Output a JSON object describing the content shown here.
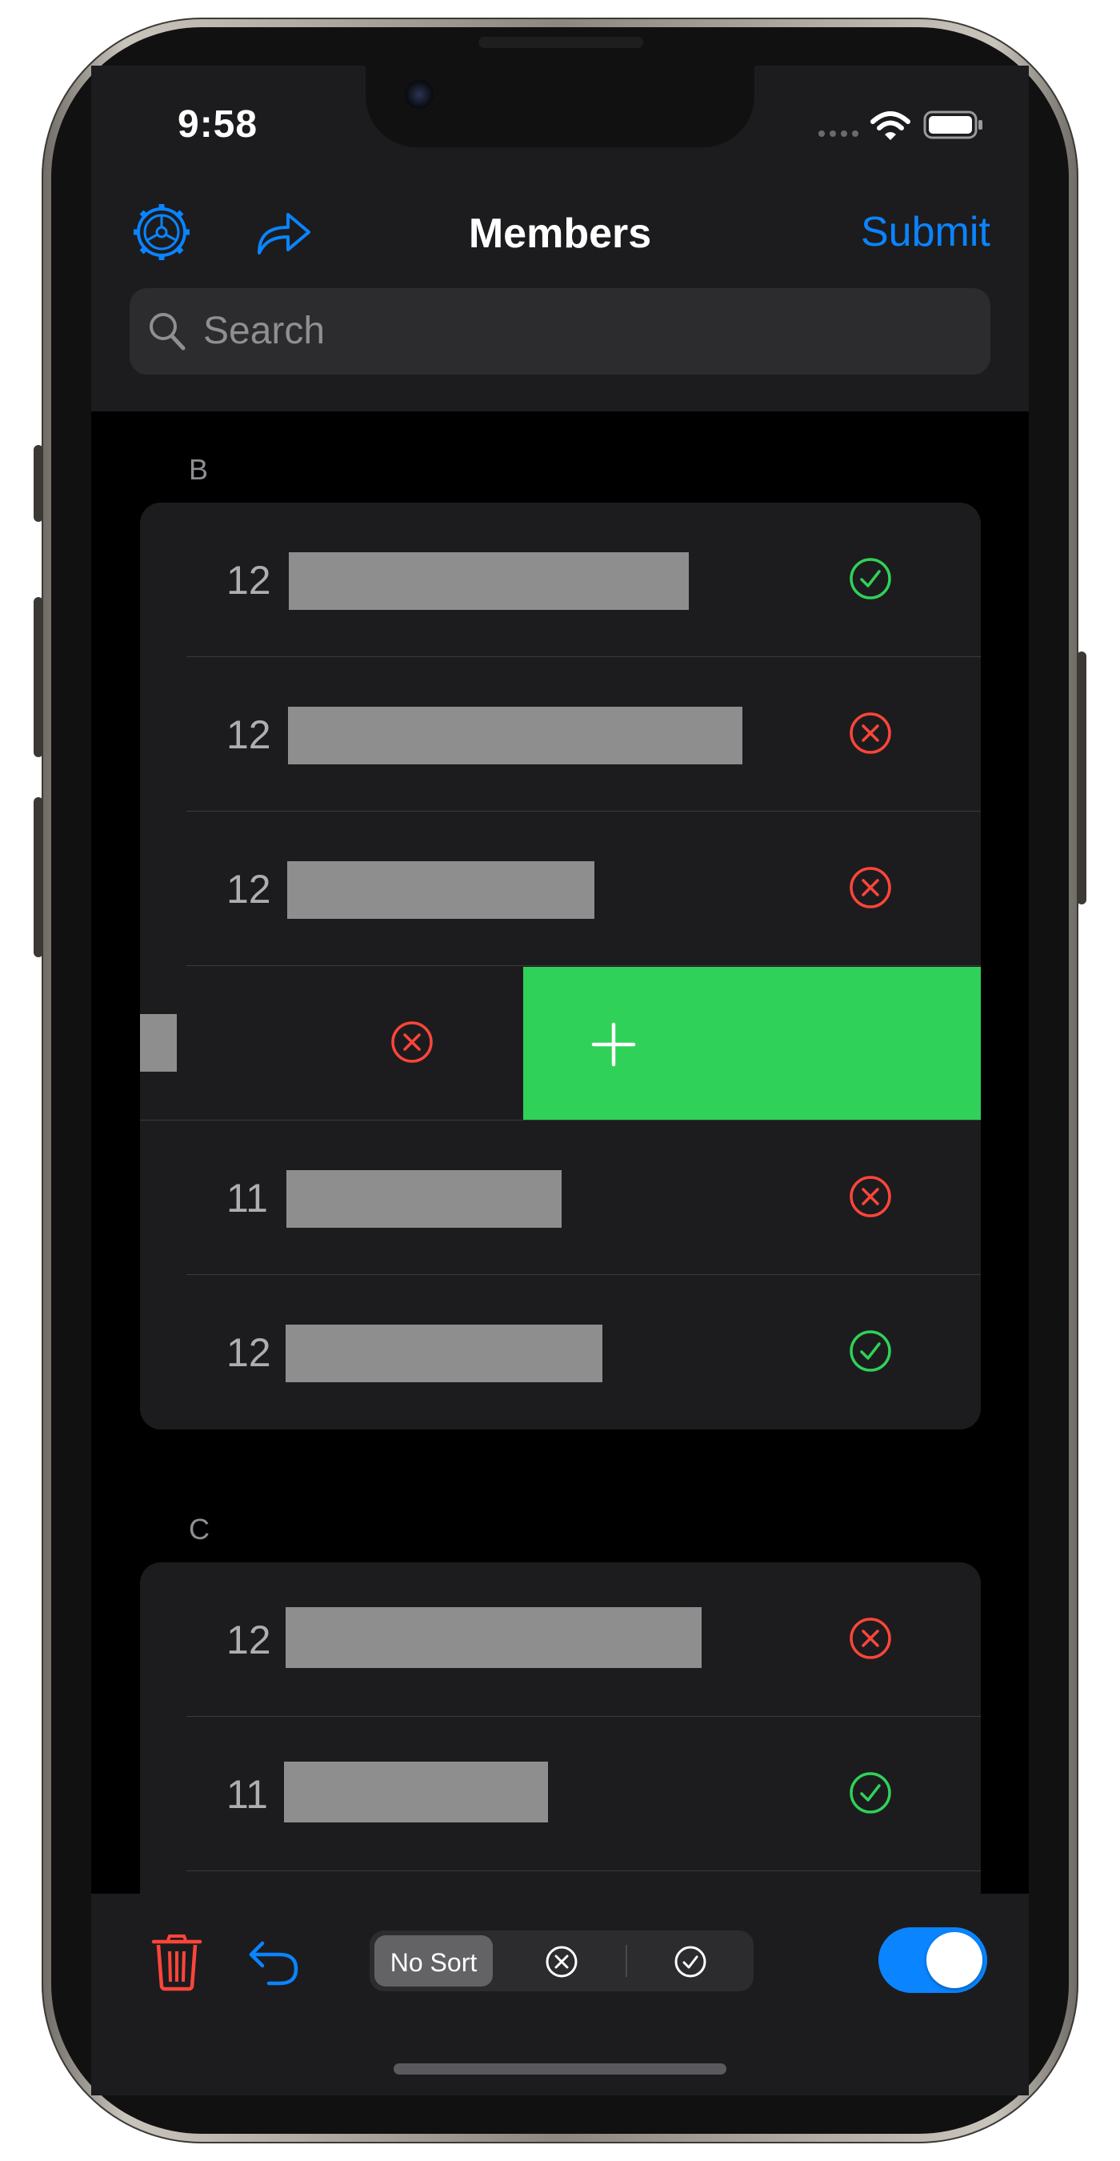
{
  "status_bar": {
    "time": "9:58"
  },
  "nav": {
    "title": "Members",
    "submit_label": "Submit",
    "settings_icon": "gear-icon",
    "share_icon": "share-arrow-icon"
  },
  "search": {
    "placeholder": "Search"
  },
  "sections": [
    {
      "header": "B",
      "rows": [
        {
          "number": "12",
          "status": "present"
        },
        {
          "number": "12",
          "status": "absent"
        },
        {
          "number": "12",
          "status": "absent"
        },
        {
          "number": "",
          "status": "absent",
          "swiped": true,
          "swipe_action": "add"
        },
        {
          "number": "11",
          "status": "absent"
        },
        {
          "number": "12",
          "status": "present"
        }
      ]
    },
    {
      "header": "C",
      "rows": [
        {
          "number": "12",
          "status": "absent"
        },
        {
          "number": "11",
          "status": "present"
        }
      ]
    }
  ],
  "toolbar": {
    "sort_options": [
      "No Sort",
      "absent-filter",
      "present-filter"
    ],
    "selected_sort": "No Sort",
    "toggle_on": true
  },
  "colors": {
    "accent": "#0a84ff",
    "present": "#30d158",
    "absent": "#ff453a",
    "swipe_action": "#30d158"
  }
}
